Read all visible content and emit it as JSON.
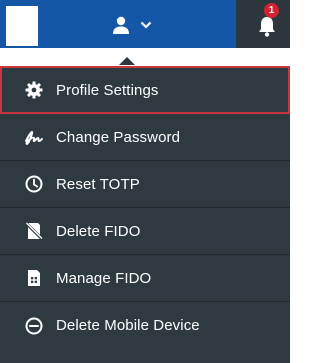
{
  "header": {
    "notification_count": "1",
    "icons": [
      "user-icon",
      "chevron-down-icon",
      "bell-icon"
    ]
  },
  "menu": {
    "items": [
      {
        "label": "Profile Settings",
        "icon": "gear-icon",
        "active": true
      },
      {
        "label": "Change Password",
        "icon": "signature-icon",
        "active": false
      },
      {
        "label": "Reset TOTP",
        "icon": "clock-icon",
        "active": false
      },
      {
        "label": "Delete FIDO",
        "icon": "device-slash-icon",
        "active": false
      },
      {
        "label": "Manage FIDO",
        "icon": "sim-card-icon",
        "active": false
      },
      {
        "label": "Delete Mobile Device",
        "icon": "minus-circle-icon",
        "active": false
      }
    ]
  },
  "colors": {
    "header_bg": "#1357a6",
    "menu_bg": "#2f3a40",
    "active_border": "#c9373e",
    "badge_bg": "#d32333"
  }
}
